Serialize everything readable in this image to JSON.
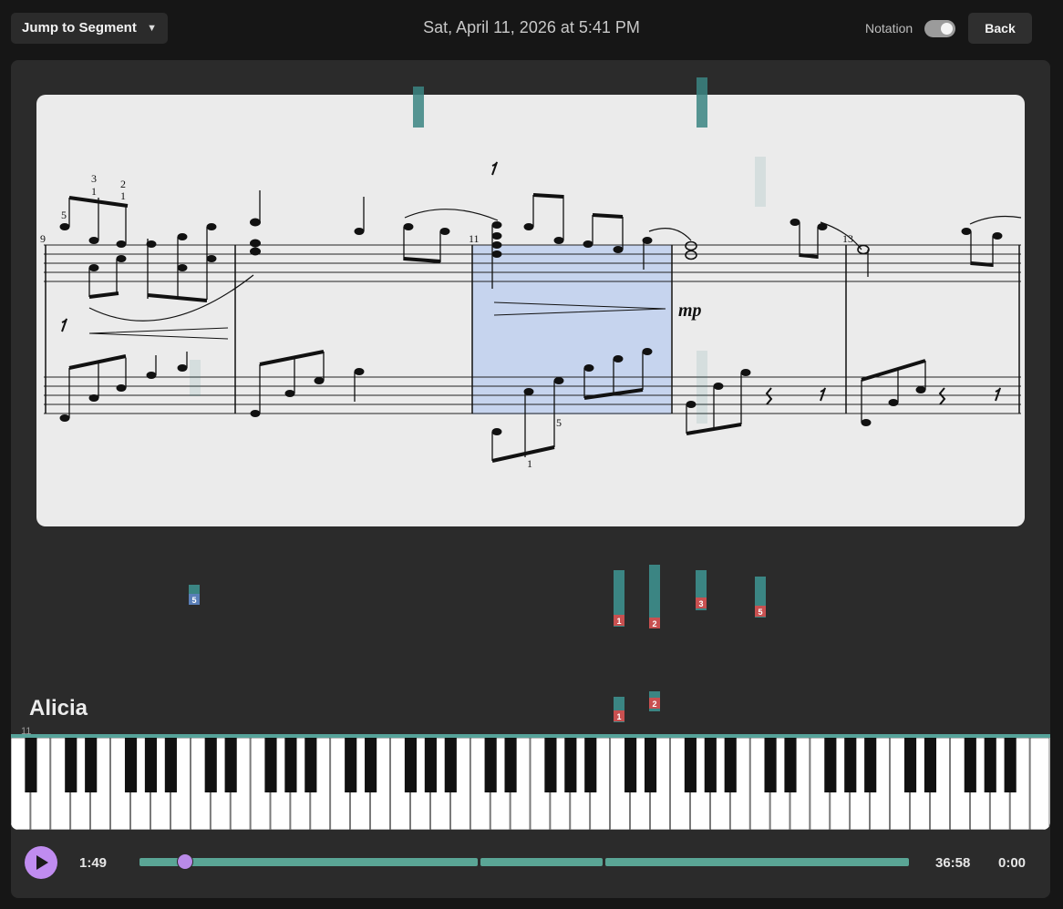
{
  "header": {
    "jump_label": "Jump to Segment",
    "jump_caret": "▼",
    "datetime": "Sat, April 11, 2026 at 5:41 PM",
    "notation_label": "Notation",
    "notation_on": true,
    "back_label": "Back"
  },
  "score": {
    "measure_numbers": [
      "9",
      "11",
      "13"
    ],
    "dynamic": "mp",
    "fingerings": [
      "3",
      "1",
      "2",
      "1",
      "5",
      "5",
      "1"
    ],
    "colors": {
      "paper": "#ebebeb",
      "ink": "#111111",
      "highlight": "#c6d4ee"
    }
  },
  "falling_notes": {
    "finger_labels": [
      "5",
      "1",
      "2",
      "3",
      "5",
      "1",
      "2"
    ],
    "colors": {
      "note_bar": "#3b8583",
      "finger_badge": "#c85050",
      "left_hand_badge": "#5a7fb8"
    }
  },
  "player": {
    "name": "Alicia",
    "measure_marker": "11"
  },
  "playback": {
    "elapsed": "1:49",
    "total": "36:58",
    "extra_time": "0:00",
    "progress": 0.059,
    "colors": {
      "accent": "#b98ae8",
      "track": "#5aa595"
    }
  }
}
